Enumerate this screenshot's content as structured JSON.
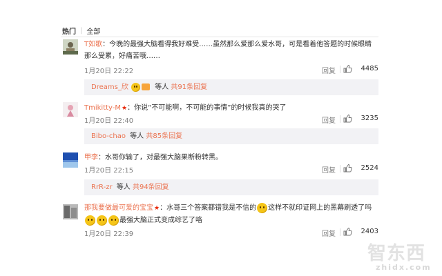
{
  "tabs": {
    "hot": "热门",
    "separator": "|",
    "all": "全部"
  },
  "comments": [
    {
      "user": "T如歌",
      "sep": "：",
      "text": "今晚的最强大脑看得我好难受……虽然那么爱那么爱水哥，可是看着他答题的时候眼睛那么受累，好痛苦哦……",
      "time": "1月20日 22:22",
      "reply": "回复",
      "likes": "4485",
      "sub": {
        "user": "Dreams_欣",
        "mid": "等人",
        "link": "共91条回复"
      }
    },
    {
      "user": "Tmikitty-M",
      "vip": "★",
      "sep": "：",
      "text": "你说“不可能啊，不可能的事情”的时候我真的哭了",
      "time": "1月20日 22:40",
      "reply": "回复",
      "likes": "3235",
      "sub": {
        "user": "Bibo-chao",
        "mid": "等人",
        "link": "共85条回复"
      }
    },
    {
      "user": "甲李",
      "sep": "：",
      "text": "水哥你输了，对最强大脑果断粉转黑。",
      "time": "1月20日 22:15",
      "reply": "回复",
      "likes": "2524",
      "sub": {
        "user": "RrR-zr",
        "mid": "等人",
        "link": "共94条回复"
      }
    },
    {
      "user": "那我要做最可爱的宝宝",
      "vip": "★",
      "sep": "：",
      "text_a": "水哥三个答案都错我是不信的",
      "text_b": "这样不就印证网上的黑幕刷透了吗",
      "text_c": "最强大脑正式变成综艺了咯",
      "time": "1月20日 22:39",
      "reply": "回复",
      "likes": "2403"
    }
  ],
  "watermark": {
    "cn": "智东西",
    "en": "zhidx.com"
  },
  "colors": {
    "username": "#eb7350",
    "vip": "#e8290b",
    "sub_bg": "#f2f2f5",
    "meta": "#808080"
  },
  "icons": {
    "like": "thumbs-up-icon",
    "emoji": "smile-emoji-icon"
  }
}
